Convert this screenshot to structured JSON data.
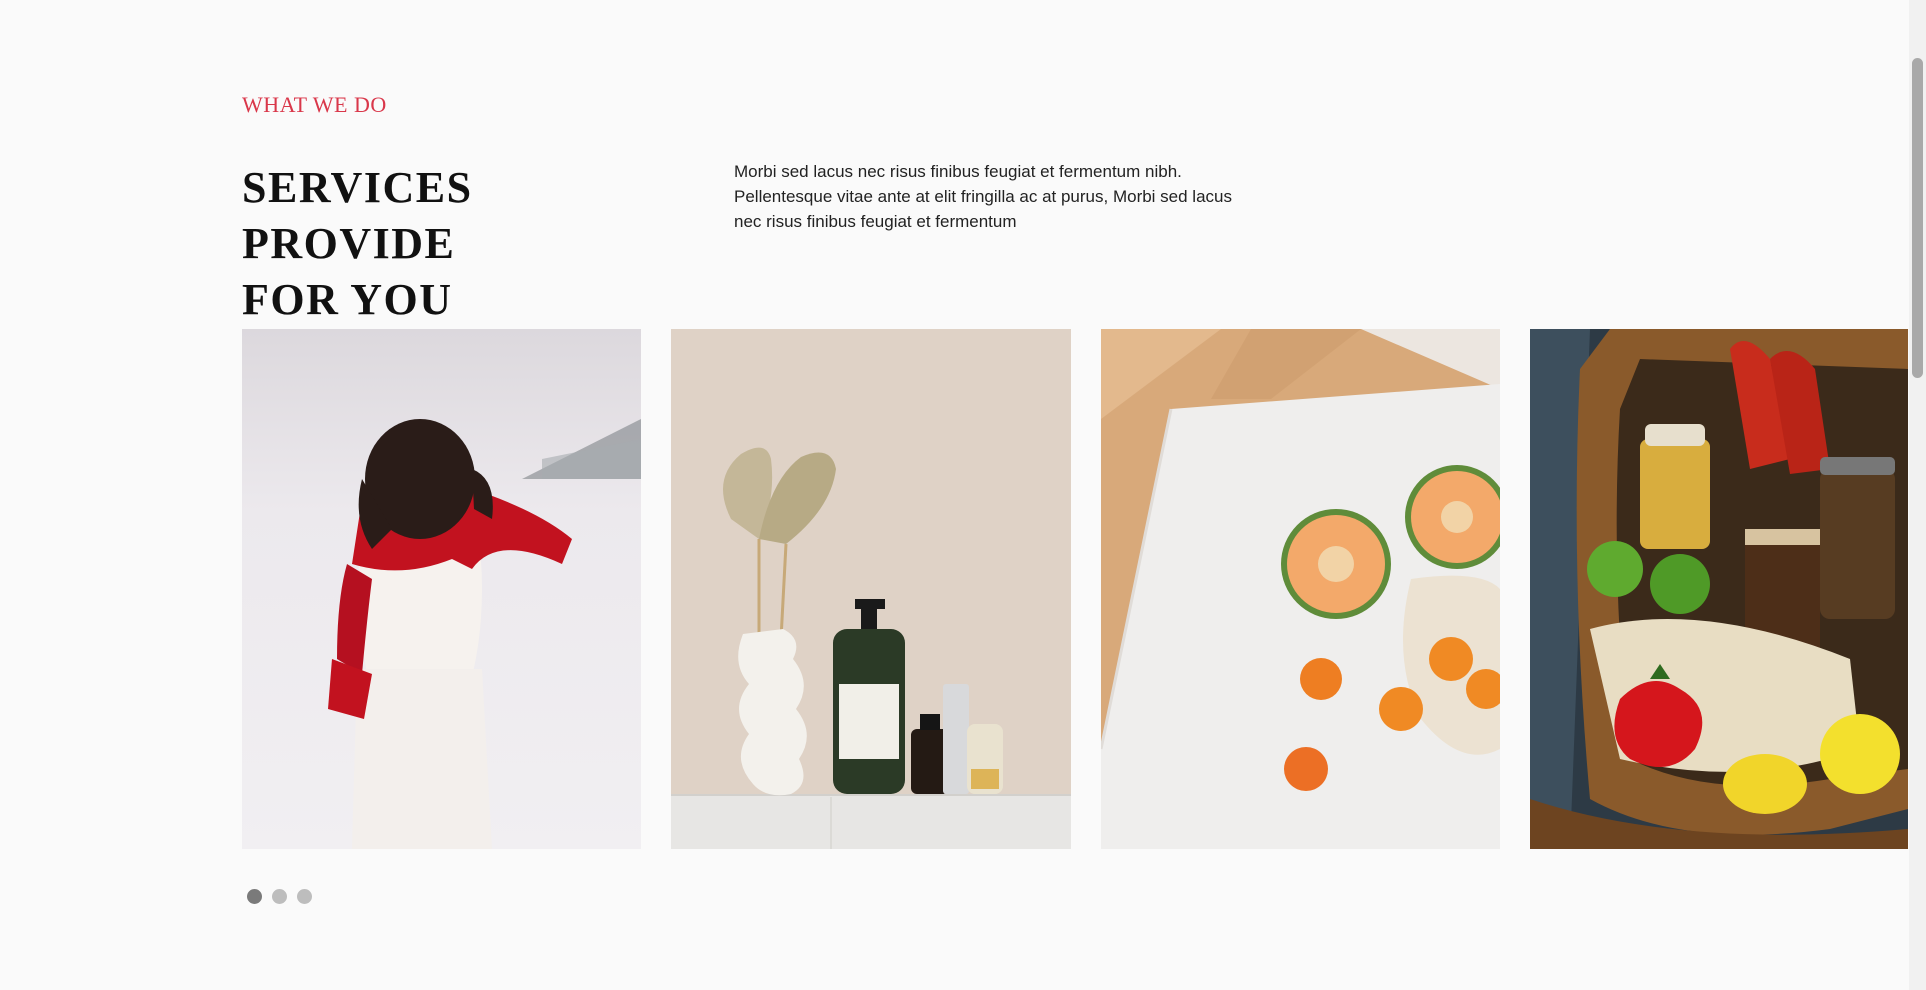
{
  "section": {
    "eyebrow": "WHAT WE DO",
    "title_lines": [
      "SERVICES PROVIDE",
      "FOR YOU"
    ],
    "description_lines": [
      "Morbi sed lacus nec risus finibus feugiat et fermentum nibh.",
      "Pellentesque vitae ante at elit fringilla ac at purus, Morbi sed lacus",
      "nec risus finibus feugiat et fermentum"
    ]
  },
  "carousel": {
    "cards": [
      {
        "name": "woman-red-scarf-snow-photo"
      },
      {
        "name": "vase-skincare-products-photo"
      },
      {
        "name": "melon-apricots-marble-photo"
      },
      {
        "name": "wicker-basket-groceries-photo"
      }
    ],
    "dots": 3,
    "active_dot": 0
  },
  "colors": {
    "accent": "#d9374a",
    "background": "#fafafa",
    "heading": "#111111",
    "dot_active": "#7a7a7a",
    "dot_inactive": "#bdbdbd"
  }
}
